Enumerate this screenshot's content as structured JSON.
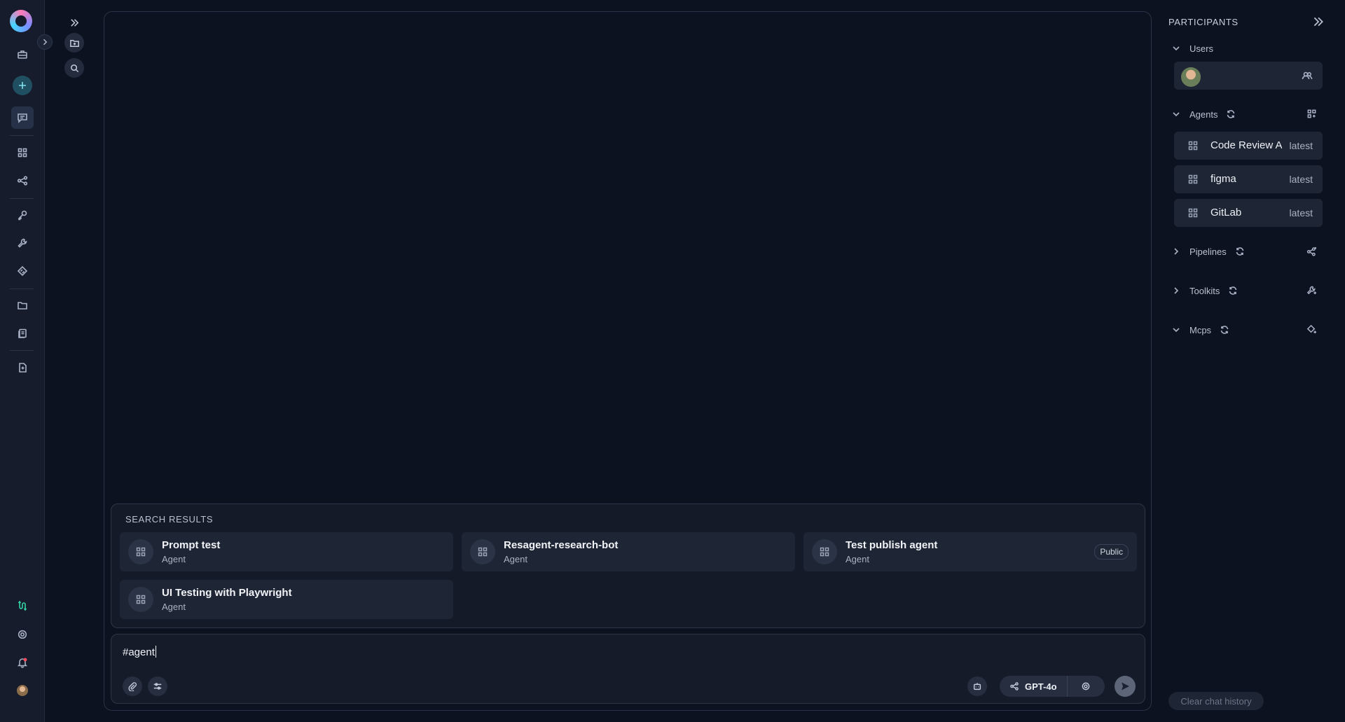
{
  "nav": {
    "items": [
      "logo",
      "briefcase",
      "add",
      "chat",
      "agents",
      "pipelines",
      "credentials",
      "toolkits",
      "mcps",
      "folder",
      "artifacts",
      "docs",
      "integrations",
      "settings",
      "notifications",
      "profile"
    ]
  },
  "sidebar": {
    "icons": [
      "expand-icon",
      "folder-icon",
      "search-icon"
    ]
  },
  "search_results": {
    "header": "SEARCH RESULTS",
    "items": [
      {
        "title": "Prompt test",
        "type": "Agent",
        "badge": ""
      },
      {
        "title": "Resagent-research-bot",
        "type": "Agent",
        "badge": ""
      },
      {
        "title": "Test publish agent",
        "type": "Agent",
        "badge": "Public"
      },
      {
        "title": "UI Testing with Playwright",
        "type": "Agent",
        "badge": ""
      }
    ]
  },
  "composer": {
    "text": "#agent",
    "model": "GPT-4o"
  },
  "participants": {
    "title": "PARTICIPANTS",
    "sections": {
      "users": "Users",
      "agents": "Agents",
      "pipelines": "Pipelines",
      "toolkits": "Toolkits",
      "mcps": "Mcps"
    },
    "agents": [
      {
        "name": "Code Review Agent",
        "version": "latest"
      },
      {
        "name": "figma",
        "version": "latest"
      },
      {
        "name": "GitLab",
        "version": "latest"
      }
    ],
    "clear_label": "Clear chat history"
  },
  "colors": {
    "background": "#0d1220",
    "panel": "#1e2535",
    "accent": "#1f4f60"
  }
}
